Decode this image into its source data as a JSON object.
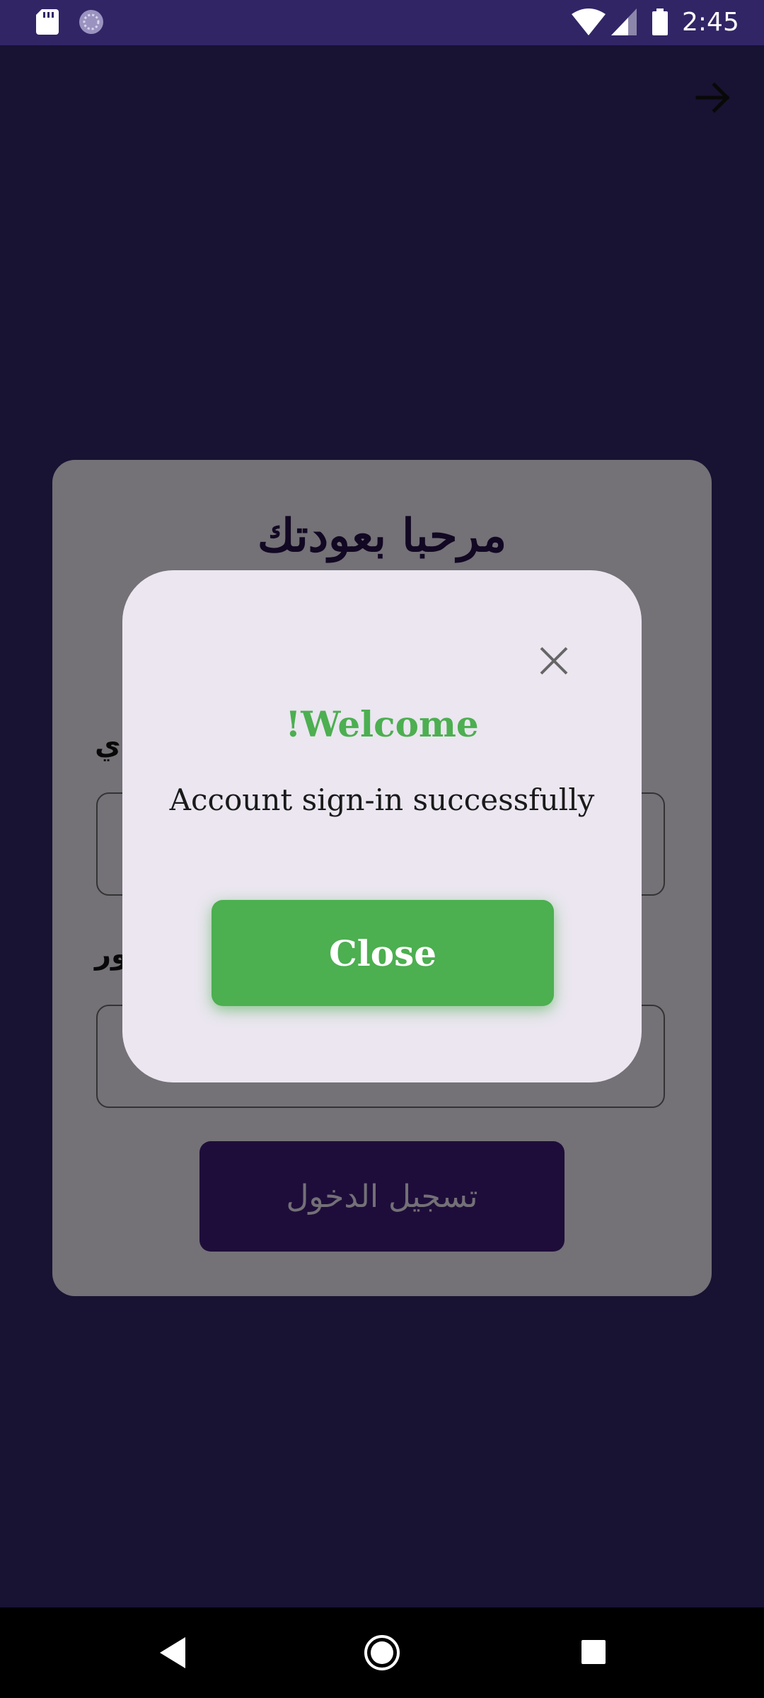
{
  "status_bar": {
    "time": "2:45",
    "icons": [
      "sd-card-icon",
      "sync-icon",
      "wifi-icon",
      "signal-icon",
      "battery-icon"
    ]
  },
  "toolbar": {
    "forward_icon": "arrow-forward-icon"
  },
  "login_card": {
    "title": "مرحبا بعودتك",
    "field1_label": "ي",
    "field2_label": "ور",
    "login_button_label": "تسجيل الدخول"
  },
  "dialog": {
    "close_icon": "close-icon",
    "title": "!Welcome",
    "message": "Account sign-in successfully",
    "close_button_label": "Close"
  },
  "nav_bar": {
    "icons": [
      "back-icon",
      "home-icon",
      "recents-icon"
    ]
  },
  "colors": {
    "background": "#312566",
    "card": "#e8e2ee",
    "dialog": "#ebe6f0",
    "accent_green": "#4caf50",
    "primary_purple": "#3c1a74"
  }
}
